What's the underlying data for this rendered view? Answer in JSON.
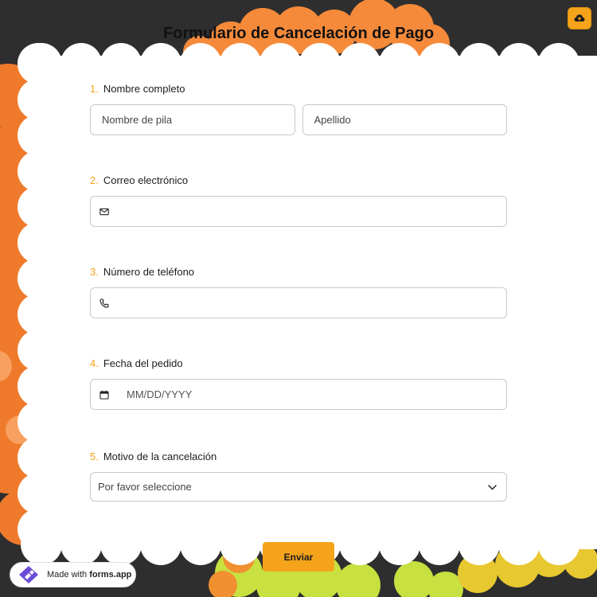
{
  "page": {
    "title": "Formulario de Cancelación de Pago"
  },
  "colors": {
    "accent": "#f5a31a",
    "background": "#2e2e2e",
    "orange_blob": "#f08030",
    "green_blob": "#b8e030"
  },
  "questions": [
    {
      "number": "1.",
      "label": "Nombre completo",
      "fields": [
        {
          "placeholder": "Nombre de pila"
        },
        {
          "placeholder": "Apellido"
        }
      ]
    },
    {
      "number": "2.",
      "label": "Correo electrónico",
      "icon": "envelope-icon"
    },
    {
      "number": "3.",
      "label": "Número de teléfono",
      "icon": "phone-icon"
    },
    {
      "number": "4.",
      "label": "Fecha del pedido",
      "icon": "calendar-icon",
      "placeholder": "MM/DD/YYYY"
    },
    {
      "number": "5.",
      "label": "Motivo de la cancelación",
      "selected": "Por favor seleccione",
      "icon": "chevron-down-icon"
    }
  ],
  "submit": {
    "label": "Enviar"
  },
  "badge": {
    "prefix": "Made with ",
    "brand": "forms.app"
  },
  "toolbar": {
    "icon": "cloud-upload-icon"
  }
}
